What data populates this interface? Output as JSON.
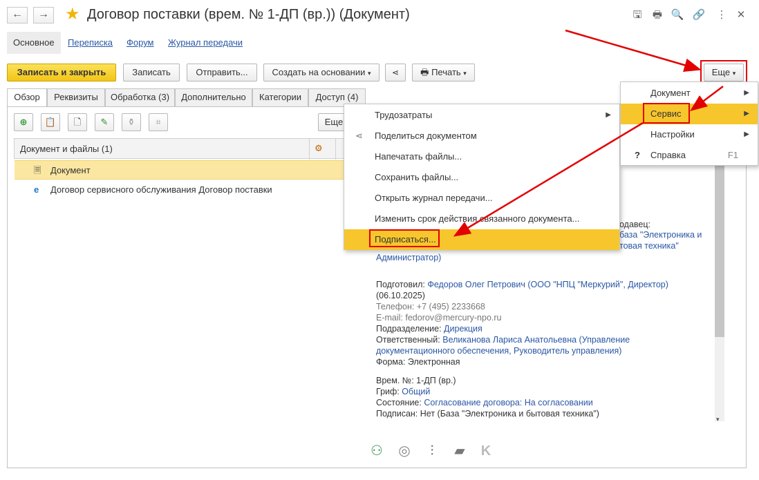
{
  "window": {
    "title": "Договор поставки (врем. № 1-ДП (вр.)) (Документ)",
    "back_icon": "←",
    "forward_icon": "→",
    "star_icon": "★",
    "toolbar_icons": [
      "save-icon",
      "print-icon",
      "preview-icon",
      "link-icon",
      "more-icon",
      "close-icon"
    ],
    "toolbar_glyphs": [
      "🖫",
      "🖶",
      "🔍",
      "🔗",
      "⋮",
      "✕"
    ]
  },
  "sections": [
    "Основное",
    "Переписка",
    "Форум",
    "Журнал передачи"
  ],
  "toolbar": {
    "save_close": "Записать и закрыть",
    "save": "Записать",
    "send": "Отправить...",
    "create_based": "Создать на основании",
    "share_icon": "share-icon",
    "print": "Печать",
    "more": "Еще"
  },
  "tabs": [
    "Обзор",
    "Реквизиты",
    "Обработка (3)",
    "Дополнительно",
    "Категории",
    "Доступ (4)"
  ],
  "files": {
    "header": "Документ и файлы (1)",
    "more": "Еще",
    "rows": [
      "Документ",
      "Договор сервисного обслуживания Договор поставки"
    ]
  },
  "more_menu": {
    "items": [
      {
        "label": "Документ",
        "submenu": true
      },
      {
        "label": "Сервис",
        "submenu": true
      },
      {
        "label": "Настройки",
        "submenu": true
      },
      {
        "label": "Справка",
        "shortcut": "F1"
      }
    ]
  },
  "service_menu": {
    "items": [
      {
        "label": "Трудозатраты",
        "submenu": true
      },
      {
        "label": "Поделиться документом"
      },
      {
        "label": "Напечатать файлы..."
      },
      {
        "label": "Сохранить файлы..."
      },
      {
        "label": "Открыть журнал передачи..."
      },
      {
        "label": "Изменить срок действия связанного документа..."
      },
      {
        "label": "Подписаться..."
      }
    ]
  },
  "info": {
    "seller_label": "одавец:",
    "seller_value_1": "база \"Электроника и",
    "seller_value_2": "товая техника\"",
    "admin": "Администратор)",
    "prepared_label": "Подготовил:",
    "prepared_value": "Федоров Олег Петрович (ООО \"НПЦ \"Меркурий\", Директор)",
    "prepared_date": "(06.10.2025)",
    "phone": "Телефон: +7 (495) 2233668",
    "email": "E-mail: fedorov@mercury-npo.ru",
    "dept_label": "Подразделение:",
    "dept_value": "Дирекция",
    "resp_label": "Ответственный:",
    "resp_value_1": "Великанова Лариса Анатольевна (Управление",
    "resp_value_2": "документационного обеспечения, Руководитель управления)",
    "form_label": "Форма:",
    "form_value": "Электронная",
    "num_label": "Врем. №:",
    "num_value": "1-ДП (вр.)",
    "grif_label": "Гриф:",
    "grif_value": "Общий",
    "state_label": "Состояние:",
    "state_value": "Согласование договора: На согласовании",
    "signed_label": "Подписан:",
    "signed_value": "Нет (База \"Электроника и бытовая техника\")"
  },
  "colors": {
    "accent": "#f7c62c",
    "link": "#2a57a4",
    "highlight_box": "#e30000"
  }
}
